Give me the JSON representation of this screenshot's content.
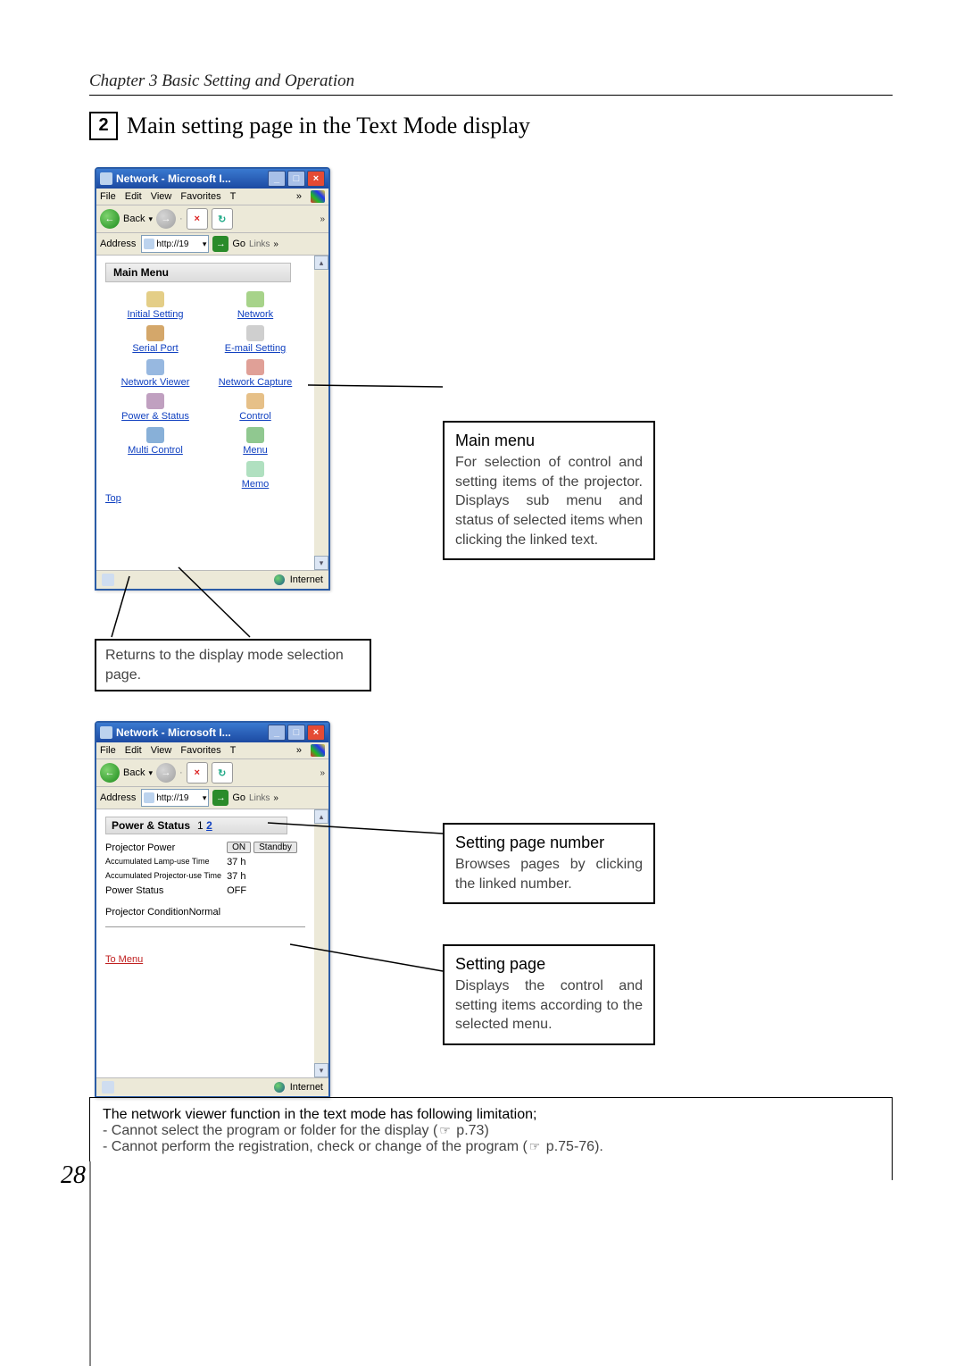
{
  "chapter_header": "Chapter 3 Basic Setting and Operation",
  "section_number": "2",
  "section_title": "Main setting page in the Text Mode display",
  "page_number": "28",
  "ie": {
    "title": "Network - Microsoft I...",
    "menu": [
      "File",
      "Edit",
      "View",
      "Favorites",
      "T",
      "»"
    ],
    "back": "Back",
    "addr_label": "Address",
    "addr_value": "http://19",
    "go": "Go",
    "links": "Links",
    "status": "Internet"
  },
  "main_menu": {
    "title": "Main Menu",
    "items": [
      "Initial Setting",
      "Network",
      "Serial Port",
      "E-mail Setting",
      "Network Viewer",
      "Network Capture",
      "Power & Status",
      "Control",
      "Multi Control",
      "Menu",
      "",
      "Memo"
    ],
    "top": "Top"
  },
  "callouts": {
    "mainmenu_title": "Main menu",
    "mainmenu_body": "For selection of  control and setting items of the projector. Displays sub menu and status of selected items when clicking the linked text.",
    "returns": "Returns to the display mode selection page.",
    "pagenum_title": "Setting page number",
    "pagenum_body": "Browses pages by clicking the linked number.",
    "settingpage_title": "Setting page",
    "settingpage_body": "Displays the control and setting items according to the selected menu."
  },
  "power_status": {
    "header": "Power & Status",
    "page_current": "1",
    "page_other": "2",
    "rows": [
      {
        "label": "Projector Power",
        "btn1": "ON",
        "btn2": "Standby"
      },
      {
        "label": "Accumulated Lamp-use Time",
        "value": "37 h"
      },
      {
        "label": "Accumulated Projector-use Time",
        "value": "37 h"
      },
      {
        "label": "Power Status",
        "value": "OFF"
      }
    ],
    "condition_label": "Projector Condition",
    "condition_value": "Normal",
    "to_menu": "To Menu"
  },
  "footer": {
    "line1": "The network viewer function in the text mode has following limitation;",
    "line2a": "- Cannot select the program or folder for the display (",
    "line2b": " p.73)",
    "line3a": "- Cannot perform the registration, check or change of the program (",
    "line3b": " p.75-76)."
  }
}
